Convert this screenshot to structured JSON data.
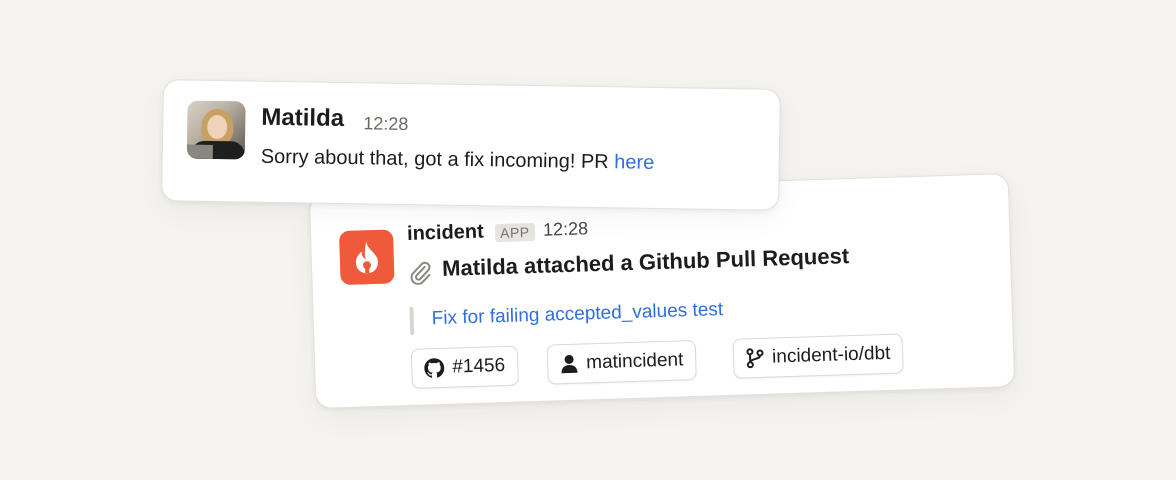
{
  "message": {
    "author": "Matilda",
    "time": "12:28",
    "text": "Sorry about that, got a fix incoming! PR",
    "link_text": "here"
  },
  "app_message": {
    "app_name": "incident",
    "badge": "APP",
    "time": "12:28",
    "headline": "Matilda attached a Github Pull Request",
    "pr_title": "Fix for failing accepted_values test",
    "chips": [
      {
        "icon": "github-icon",
        "label": "#1456"
      },
      {
        "icon": "user-icon",
        "label": "matincident"
      },
      {
        "icon": "git-branch-icon",
        "label": "incident-io/dbt"
      }
    ]
  },
  "colors": {
    "background": "#f5f3ef",
    "link": "#2f6fd9",
    "brand": "#ef5a3a"
  }
}
